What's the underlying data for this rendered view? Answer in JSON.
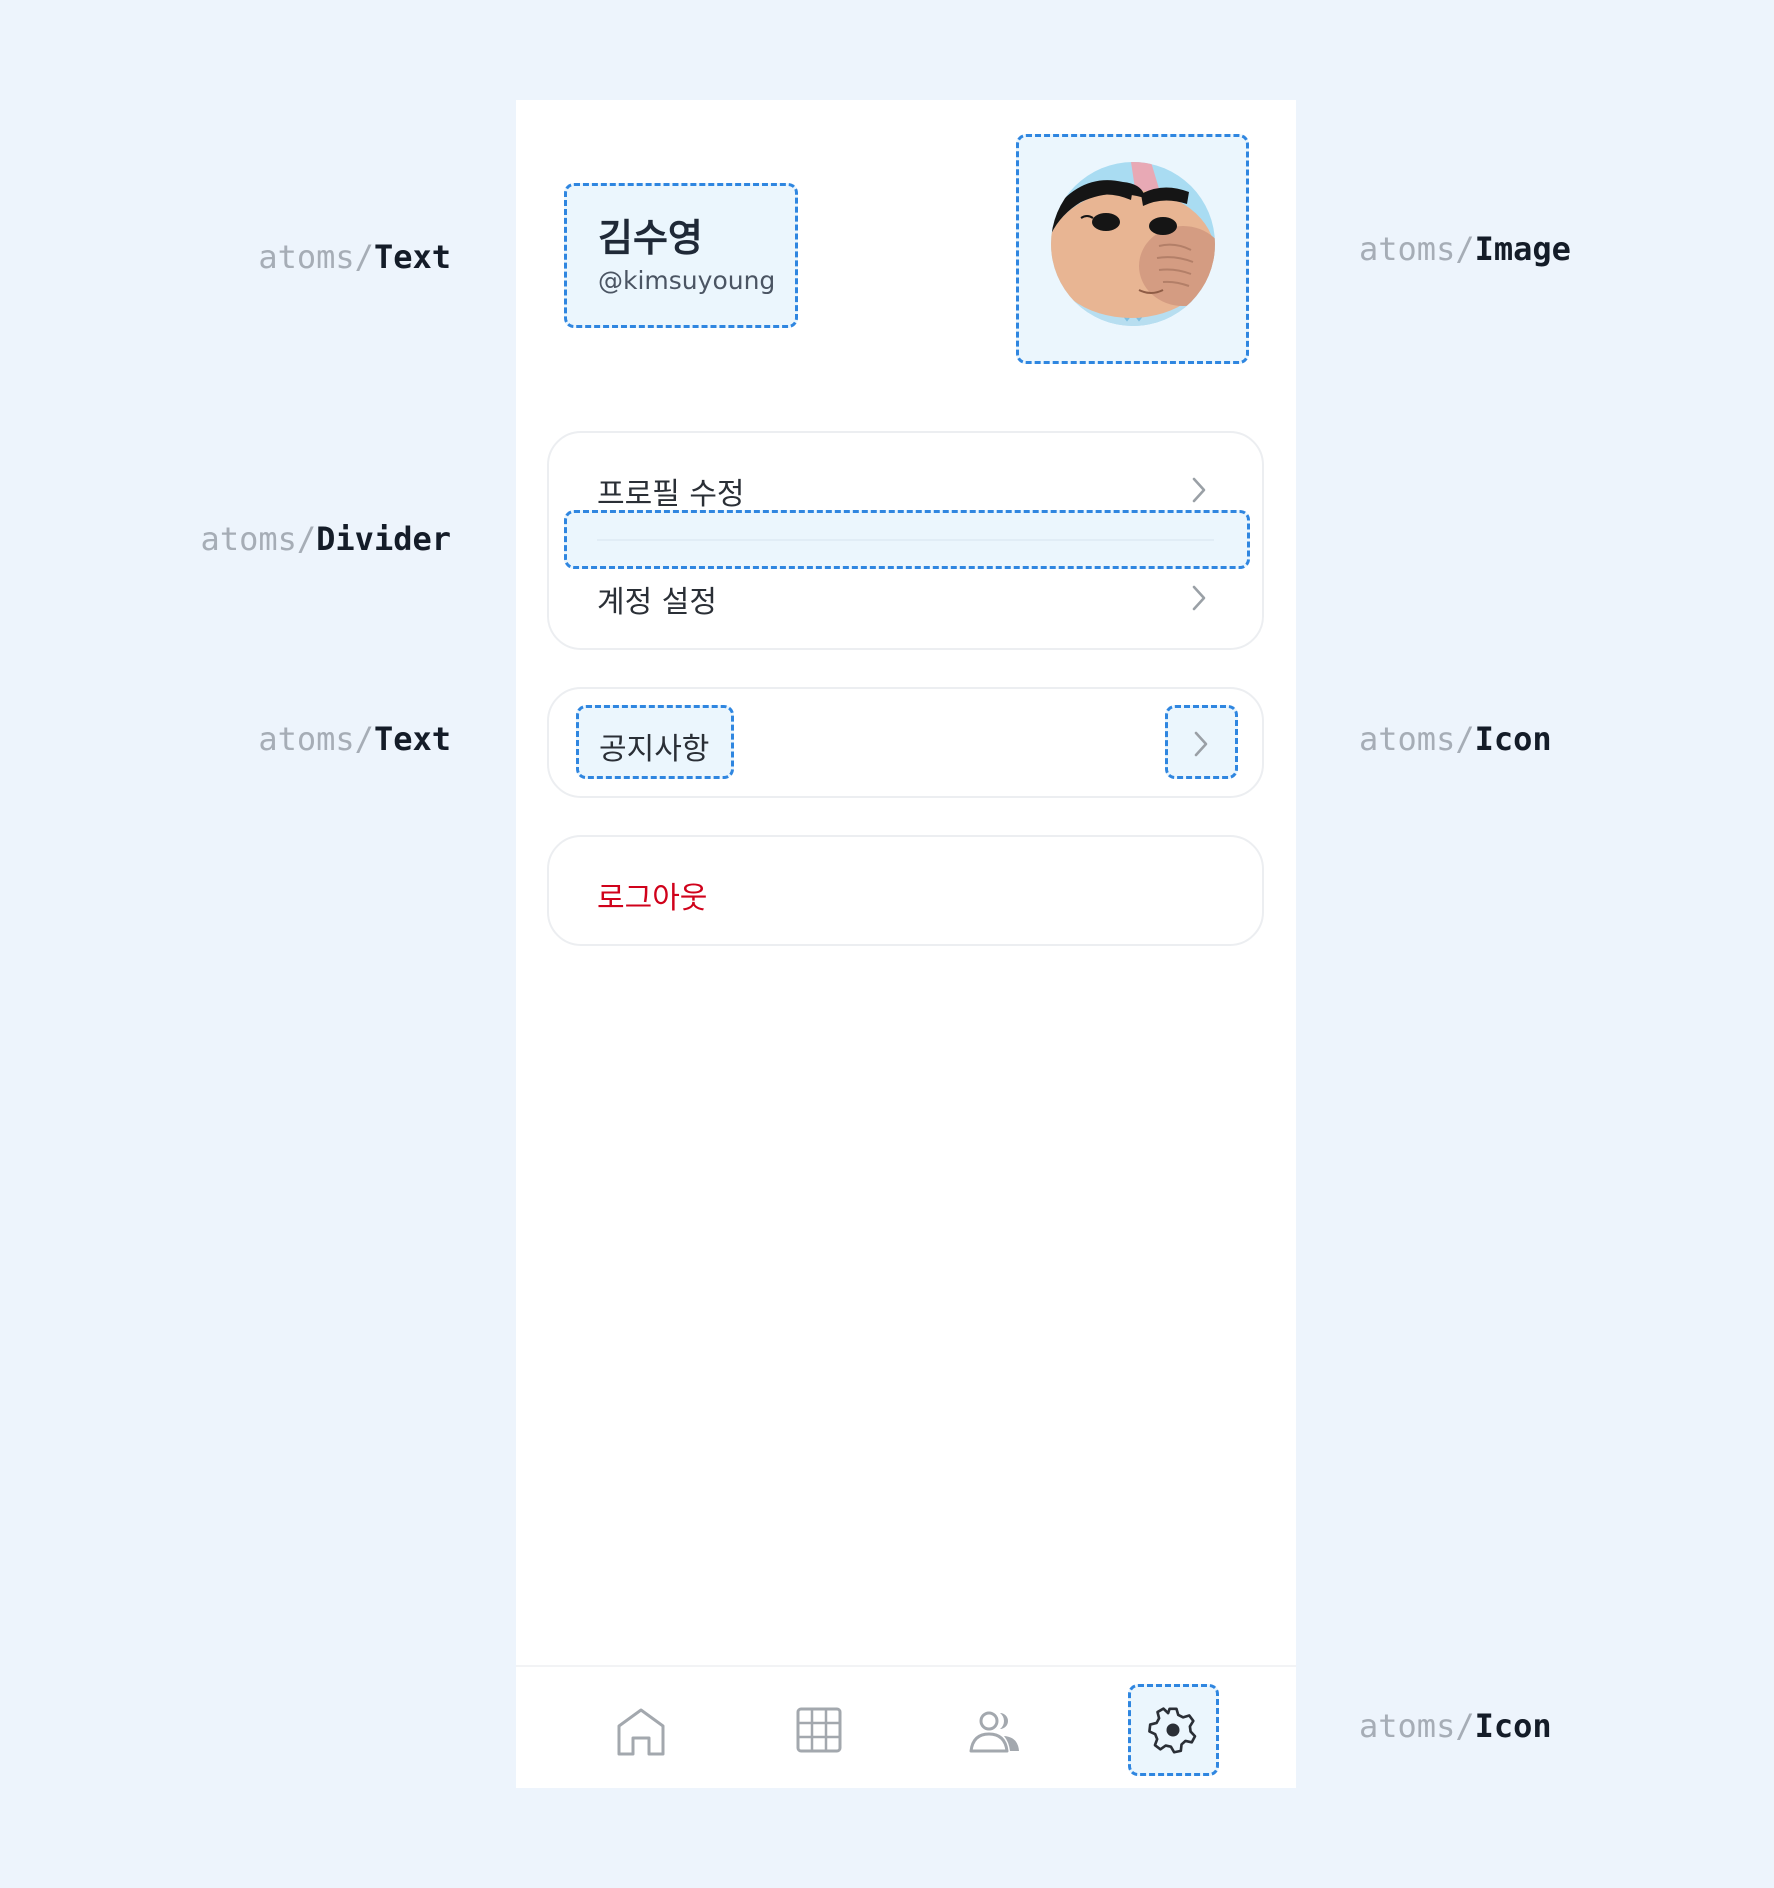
{
  "annotations": {
    "prefix": "atoms/",
    "text_top": "Text",
    "divider": "Divider",
    "text_mid": "Text",
    "image": "Image",
    "icon_mid": "Icon",
    "icon_bottom": "Icon"
  },
  "profile": {
    "name": "김수영",
    "handle": "@kimsuyoung",
    "avatar_icon": "profile-avatar-image"
  },
  "menu": {
    "edit_profile": "프로필 수정",
    "account_settings": "계정 설정",
    "notices": "공지사항",
    "logout": "로그아웃"
  },
  "tabbar": {
    "items": [
      {
        "icon": "home-icon"
      },
      {
        "icon": "grid-icon"
      },
      {
        "icon": "users-icon"
      },
      {
        "icon": "gear-icon",
        "selected": true
      }
    ]
  },
  "colors": {
    "background": "#edf4fc",
    "highlight_border": "#2f86e0",
    "logout_text": "#d0021b",
    "card_border": "#eceef1"
  }
}
